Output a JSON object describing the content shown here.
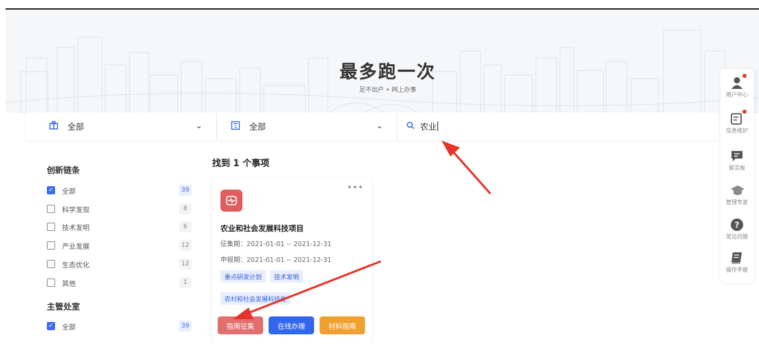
{
  "hero": {
    "title": "最多跑一次",
    "subtitle": "足不出户 • 网上办事"
  },
  "filters": {
    "dept": {
      "value": "全部",
      "icon": "building-icon"
    },
    "type": {
      "value": "全部",
      "icon": "document-icon"
    },
    "search": {
      "value": "农业",
      "icon": "search-icon"
    }
  },
  "sidebar": {
    "section1": {
      "title": "创新链条",
      "items": [
        {
          "label": "全部",
          "count": "39",
          "checked": true
        },
        {
          "label": "科学发现",
          "count": "8",
          "checked": false
        },
        {
          "label": "技术发明",
          "count": "6",
          "checked": false
        },
        {
          "label": "产业发展",
          "count": "12",
          "checked": false
        },
        {
          "label": "生态优化",
          "count": "12",
          "checked": false
        },
        {
          "label": "其他",
          "count": "1",
          "checked": false
        }
      ]
    },
    "section2": {
      "title": "主管处室",
      "items": [
        {
          "label": "全部",
          "count": "39",
          "checked": true
        }
      ]
    }
  },
  "results": {
    "heading": "找到 1 个事项",
    "card": {
      "title": "农业和社会发展科技项目",
      "collect_period": "征集期：2021-01-01 -- 2021-12-31",
      "apply_period": "申报期：2021-01-01 -- 2021-12-31",
      "tags": [
        "重点研发计划",
        "技术发明",
        "农村和社会发展科技处"
      ],
      "buttons": {
        "guide_collect": "指南征集",
        "online": "在线办理",
        "materials": "材料指南"
      },
      "more": "•••"
    }
  },
  "rightbar": [
    {
      "label": "用户中心",
      "icon": "user-icon",
      "badge": true
    },
    {
      "label": "信息维护",
      "icon": "edit-icon",
      "badge": true
    },
    {
      "label": "留言板",
      "icon": "message-icon",
      "badge": false
    },
    {
      "label": "管理专家",
      "icon": "graduation-cap-icon",
      "badge": false
    },
    {
      "label": "常见问题",
      "icon": "question-icon",
      "badge": false
    },
    {
      "label": "操作手册",
      "icon": "manual-icon",
      "badge": false
    }
  ],
  "colors": {
    "accent": "#2f5fe6",
    "red": "#e05e5e",
    "blue_btn": "#3366ee",
    "orange_btn": "#f0a030"
  }
}
